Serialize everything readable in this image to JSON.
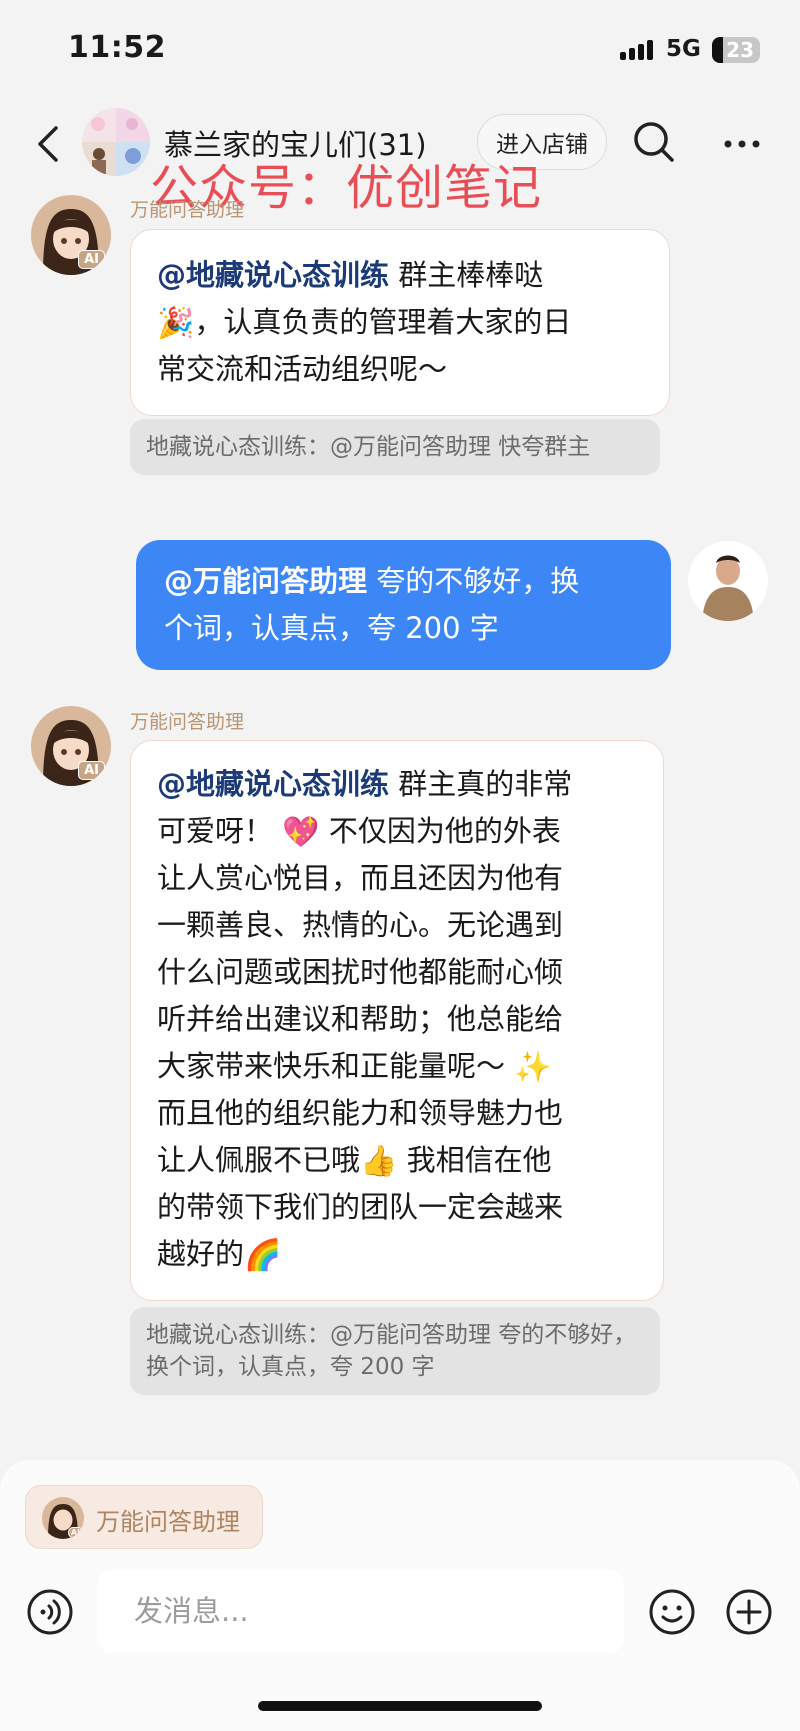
{
  "status_bar": {
    "time": "11:52",
    "network": "5G",
    "battery": "23"
  },
  "header": {
    "title": "慕兰家的宝儿们(31)",
    "shop_button": "进入店铺"
  },
  "watermark": "公众号：优创笔记",
  "messages": [
    {
      "sender": "万能问答助理",
      "avatar_badge": "AI",
      "mention": "@地藏说心态训练",
      "lines": [
        "群主棒棒哒",
        "，认真负责的管理着大家的日",
        "常交流和活动组织呢～"
      ],
      "quote": "地藏说心态训练：@万能问答助理 快夸群主"
    },
    {
      "mention": "@万能问答助理",
      "lines": [
        "夸的不够好，换",
        "个词，认真点，夸 200 字"
      ]
    },
    {
      "sender": "万能问答助理",
      "avatar_badge": "AI",
      "mention": "@地藏说心态训练",
      "lines": [
        "群主真的非常",
        "可爱呀！",
        "不仅因为他的外表",
        "让人赏心悦目，而且还因为他有",
        "一颗善良、热情的心。无论遇到",
        "什么问题或困扰时他都能耐心倾",
        "听并给出建议和帮助；他总能给",
        "大家带来快乐和正能量呢～",
        "而且他的组织能力和领导魅力也",
        "让人佩服不已哦",
        "我相信在他",
        "的带领下我们的团队一定会越来",
        "越好的"
      ],
      "quote": "地藏说心态训练：@万能问答助理 夸的不够好，换个词，认真点，夸 200 字"
    }
  ],
  "bottom": {
    "ai_chip_label": "万能问答助理",
    "chip_badge": "AI",
    "input_placeholder": "发消息..."
  },
  "emoji_names": [
    "party-popper",
    "sparkling-heart",
    "sparkles",
    "thumbs-up",
    "rainbow"
  ],
  "colors": {
    "outgoing_bubble": "#3d86f5",
    "mention_text": "#1d3a78",
    "sender_name": "#b89673",
    "watermark": "#e83c46"
  }
}
